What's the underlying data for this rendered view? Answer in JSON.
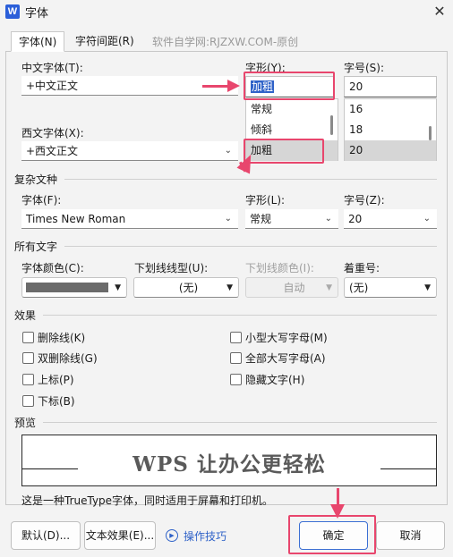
{
  "window": {
    "title": "字体",
    "app_icon": "W"
  },
  "tabs": [
    {
      "label": "字体(N)"
    },
    {
      "label": "字符间距(R)"
    }
  ],
  "watermark": "软件自学网:RJZXW.COM-原创",
  "chinese_font": {
    "label": "中文字体(T):",
    "value": "+中文正文"
  },
  "style": {
    "label": "字形(Y):",
    "value": "加粗",
    "options": [
      "常规",
      "倾斜",
      "加粗"
    ]
  },
  "size": {
    "label": "字号(S):",
    "value": "20",
    "options": [
      "16",
      "18",
      "20"
    ]
  },
  "western_font": {
    "label": "西文字体(X):",
    "value": "+西文正文"
  },
  "complex": {
    "group_title": "复杂文种",
    "font_label": "字体(F):",
    "font_value": "Times New Roman",
    "style_label": "字形(L):",
    "style_value": "常规",
    "size_label": "字号(Z):",
    "size_value": "20"
  },
  "all_text": {
    "group_title": "所有文字",
    "color_label": "字体颜色(C):",
    "color_value": "#6b6b6b",
    "underline_label": "下划线线型(U):",
    "underline_value": "(无)",
    "underline_color_label": "下划线颜色(I):",
    "underline_color_value": "自动",
    "emphasis_label": "着重号:",
    "emphasis_value": "(无)"
  },
  "effects": {
    "group_title": "效果",
    "left": [
      "删除线(K)",
      "双删除线(G)",
      "上标(P)",
      "下标(B)"
    ],
    "right": [
      "小型大写字母(M)",
      "全部大写字母(A)",
      "隐藏文字(H)"
    ]
  },
  "preview": {
    "group_title": "预览",
    "text": "WPS 让办公更轻松",
    "note": "这是一种TrueType字体，同时适用于屏幕和打印机。"
  },
  "buttons": {
    "default": "默认(D)...",
    "text_effects": "文本效果(E)...",
    "tips": "操作技巧",
    "ok": "确定",
    "cancel": "取消"
  },
  "colors": {
    "accent": "#2f62c8",
    "annotation": "#e8466d"
  }
}
